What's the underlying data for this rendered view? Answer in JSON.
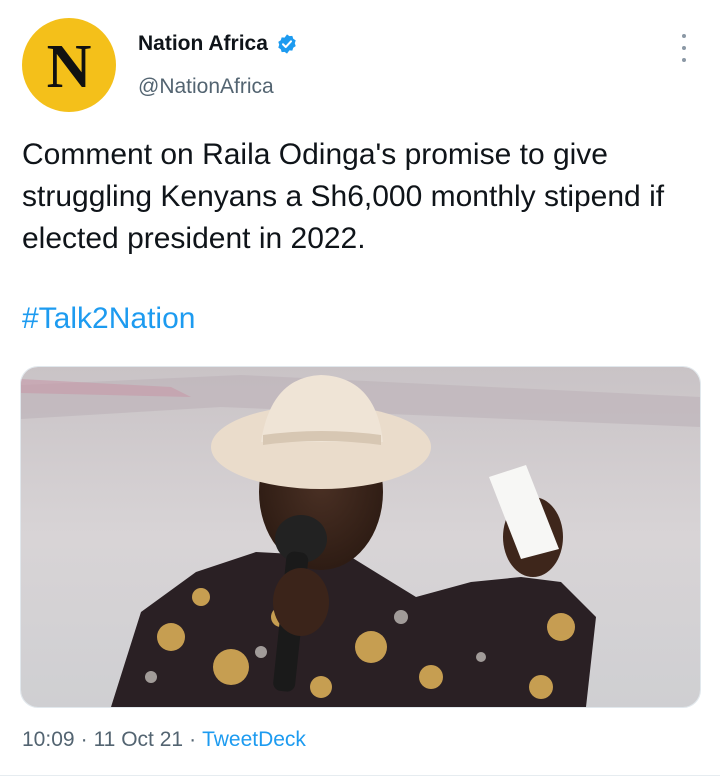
{
  "author": {
    "avatar_letter": "N",
    "avatar_color": "#f4c01a",
    "display_name": "Nation Africa",
    "verified": true,
    "handle": "@NationAfrica"
  },
  "tweet": {
    "text": "Comment on Raila Odinga's promise to give struggling Kenyans a Sh6,000 monthly stipend if elected president in 2022.",
    "hashtag": "#Talk2Nation"
  },
  "meta": {
    "time": "10:09",
    "sep1": "·",
    "date": "11 Oct 21",
    "sep2": "·",
    "source": "TweetDeck"
  },
  "colors": {
    "link": "#1d9bf0",
    "secondary_text": "#536471",
    "verified_badge": "#1d9bf0"
  },
  "icons": {
    "verified": "verified-badge-icon",
    "more": "more-options-icon"
  }
}
